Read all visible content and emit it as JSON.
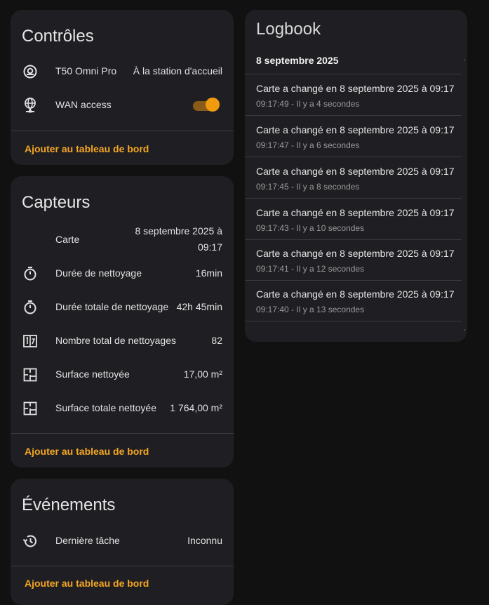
{
  "controls": {
    "title": "Contrôles",
    "device_label": "T50 Omni Pro",
    "device_value": "À la station d'accueil",
    "wan_label": "WAN access",
    "action": "Ajouter au tableau de bord"
  },
  "sensors": {
    "title": "Capteurs",
    "rows": [
      {
        "label": "Carte",
        "value_line1": "8 septembre 2025 à",
        "value_line2": "09:17",
        "icon": "none"
      },
      {
        "label": "Durée de nettoyage",
        "value": "16min",
        "icon": "timer-icon"
      },
      {
        "label": "Durée totale de nettoyage",
        "value": "42h 45min",
        "icon": "timer-icon"
      },
      {
        "label": "Nombre total de nettoyages",
        "value": "82",
        "icon": "counter-icon"
      },
      {
        "label": "Surface nettoyée",
        "value": "17,00 m²",
        "icon": "floor-plan-icon"
      },
      {
        "label": "Surface totale nettoyée",
        "value": "1 764,00 m²",
        "icon": "floor-plan-icon"
      }
    ],
    "action": "Ajouter au tableau de bord"
  },
  "events": {
    "title": "Événements",
    "last_task_label": "Dernière tâche",
    "last_task_value": "Inconnu",
    "action": "Ajouter au tableau de bord"
  },
  "logbook": {
    "title": "Logbook",
    "date": "8 septembre 2025",
    "entries": [
      {
        "message": "Carte a changé en 8 septembre 2025 à 09:17",
        "time": "09:17:49 - Il y a 4 secondes"
      },
      {
        "message": "Carte a changé en 8 septembre 2025 à 09:17",
        "time": "09:17:47 - Il y a 6 secondes"
      },
      {
        "message": "Carte a changé en 8 septembre 2025 à 09:17",
        "time": "09:17:45 - Il y a 8 secondes"
      },
      {
        "message": "Carte a changé en 8 septembre 2025 à 09:17",
        "time": "09:17:43 - Il y a 10 secondes"
      },
      {
        "message": "Carte a changé en 8 septembre 2025 à 09:17",
        "time": "09:17:41 - Il y a 12 secondes"
      },
      {
        "message": "Carte a changé en 8 septembre 2025 à 09:17",
        "time": "09:17:40 - Il y a 13 secondes"
      }
    ]
  },
  "colors": {
    "accent": "#f5a623",
    "card": "#1f1f23",
    "background": "#111111",
    "toggle_on": "#f09a0e"
  },
  "toggle_state": {
    "wan_access": true
  }
}
